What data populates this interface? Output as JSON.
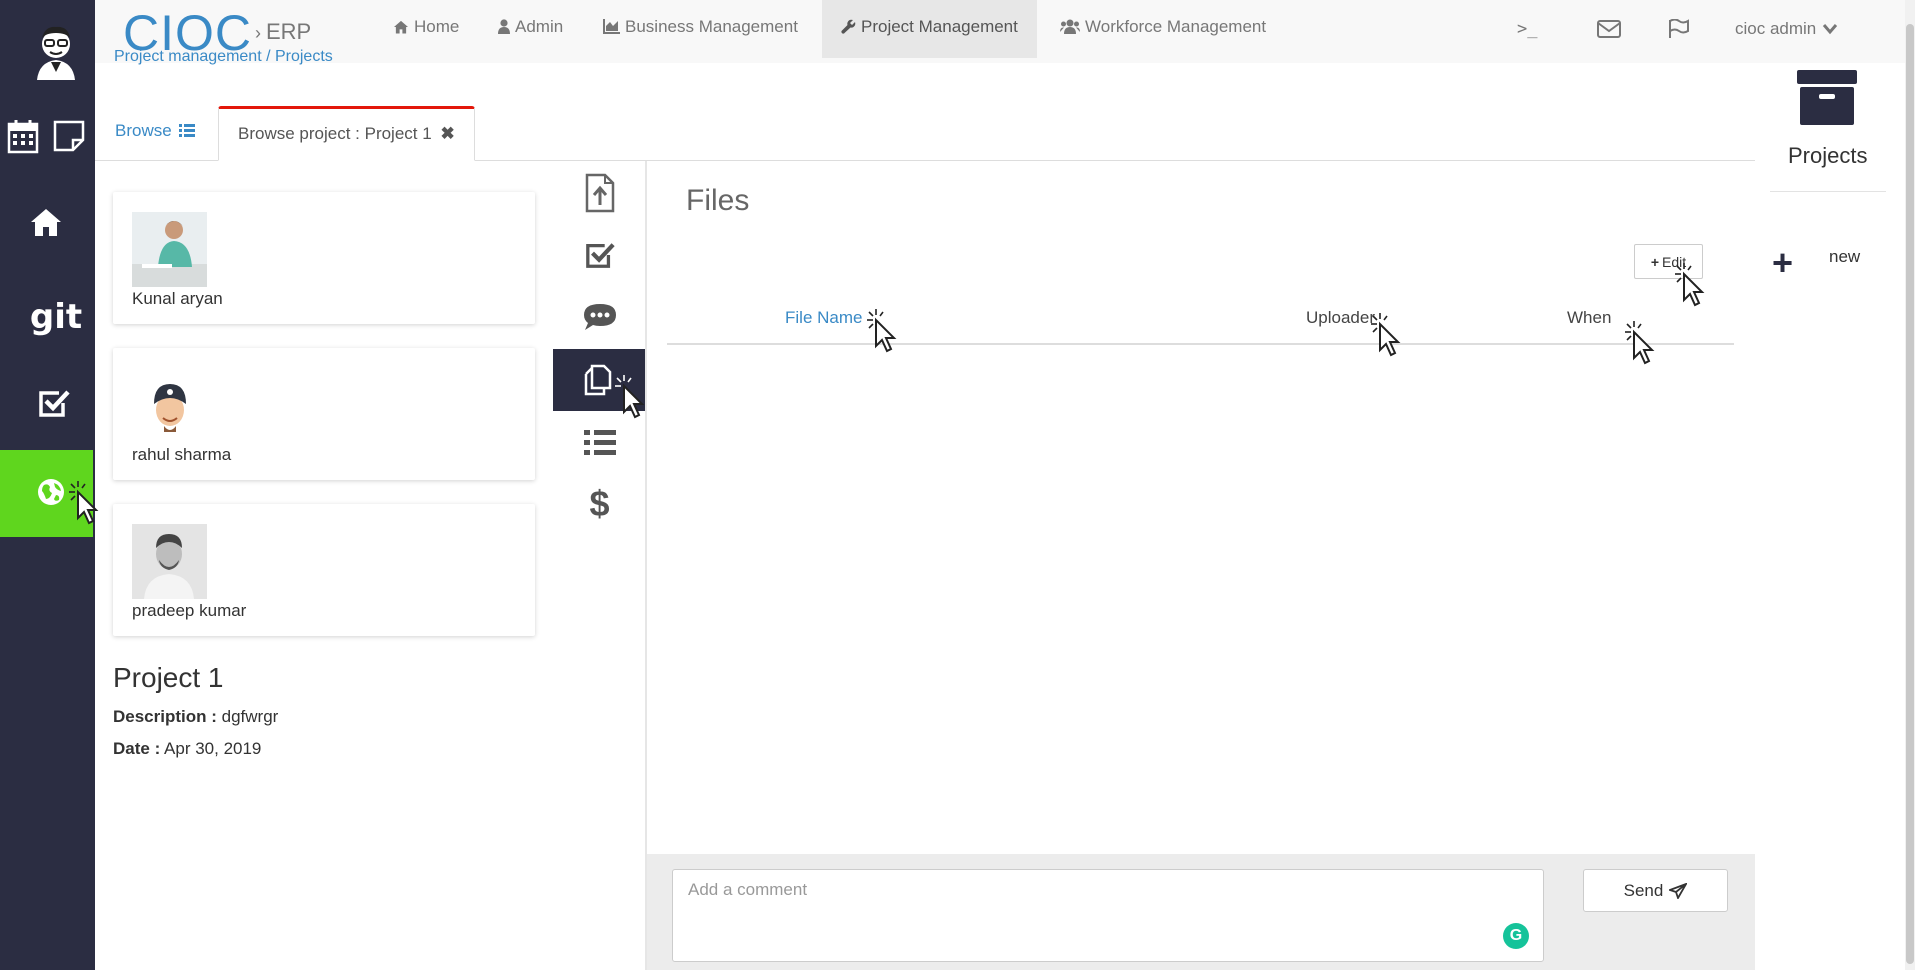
{
  "app": {
    "brand": "CIOC",
    "brand_sub": "ERP"
  },
  "nav": {
    "items": [
      {
        "label": "Home",
        "icon": "home-icon"
      },
      {
        "label": "Admin",
        "icon": "user-icon"
      },
      {
        "label": "Business Management",
        "icon": "chart-icon"
      },
      {
        "label": "Project Management",
        "icon": "wrench-icon",
        "active": true
      },
      {
        "label": "Workforce Management",
        "icon": "users-icon"
      }
    ],
    "terminal": ">_",
    "user": "cioc admin"
  },
  "breadcrumb": {
    "text": "Project management  /  Projects"
  },
  "tabs": {
    "browse": "Browse",
    "current": "Browse project : Project 1"
  },
  "members": [
    {
      "name": "Kunal aryan"
    },
    {
      "name": "rahul sharma"
    },
    {
      "name": "pradeep kumar"
    }
  ],
  "project": {
    "title": "Project 1",
    "description_label": "Description :",
    "description": "dgfwrgr",
    "date_label": "Date :",
    "date": "Apr 30, 2019"
  },
  "files": {
    "title": "Files",
    "edit_label": "Edit",
    "columns": {
      "file_name": "File Name",
      "uploader": "Uploader",
      "when": "When"
    },
    "rows": []
  },
  "comment": {
    "placeholder": "Add a comment",
    "send_label": "Send",
    "grammarly": "G"
  },
  "right_panel": {
    "projects_label": "Projects",
    "new_label": "new"
  },
  "colors": {
    "rail": "#2b2d42",
    "active_rail": "#5fd61e",
    "link": "#3a8ac6",
    "tab_accent": "#e3170a"
  }
}
